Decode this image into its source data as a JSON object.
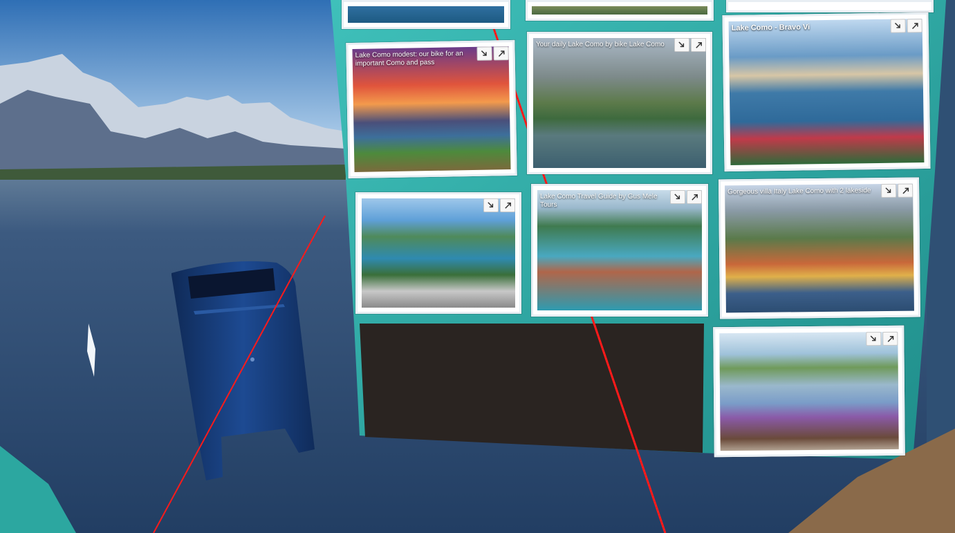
{
  "viewport_scene": {
    "colors": {
      "sky_top": "#2f6fb5",
      "sky_bottom": "#cfe6f8",
      "water": "#2c4b72",
      "wall_teal": "#2aa7a2",
      "wall_dark": "#2a2421",
      "laser": "#ff1a1a",
      "mailbox": "#163a75"
    }
  },
  "gallery": {
    "panels": [
      {
        "id": "p1",
        "caption": "Lake Como modest: our bike for an important Como and pass",
        "credit": "",
        "buttons": [
          "shrink-icon",
          "expand-icon"
        ]
      },
      {
        "id": "p2",
        "caption": "Your daily Lake Como by bike Lake Como",
        "credit": "",
        "buttons": [
          "shrink-icon",
          "expand-icon"
        ]
      },
      {
        "id": "p3",
        "caption": "Lake Como - Bravo Vi",
        "credit": "",
        "buttons": [
          "shrink-icon",
          "expand-icon"
        ]
      },
      {
        "id": "p4",
        "caption": "",
        "credit": "",
        "buttons": [
          "shrink-icon",
          "expand-icon"
        ]
      },
      {
        "id": "p5",
        "caption": "Lake Como Travel Guide by Gus Mele Tours",
        "credit": "",
        "buttons": [
          "shrink-icon",
          "expand-icon"
        ]
      },
      {
        "id": "p6",
        "caption": "Gorgeous villa Italy Lake Como with 2 lakeside",
        "credit": "",
        "buttons": [
          "shrink-icon",
          "expand-icon"
        ]
      },
      {
        "id": "p7",
        "caption": "",
        "credit": "",
        "buttons": [
          "shrink-icon",
          "expand-icon"
        ]
      }
    ]
  }
}
